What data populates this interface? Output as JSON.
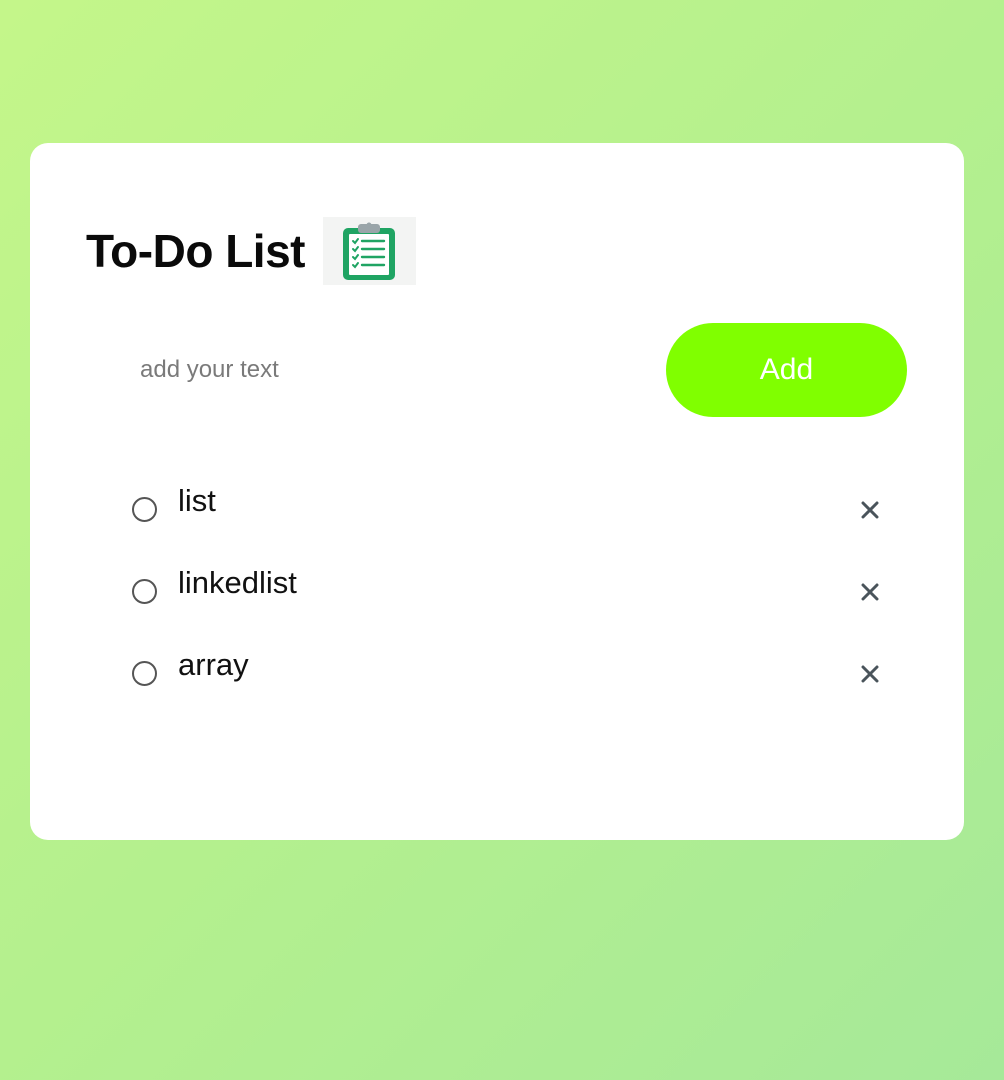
{
  "app": {
    "title": "To-Do List",
    "title_icon": "clipboard-checklist-icon"
  },
  "input": {
    "placeholder": "add your text",
    "value": ""
  },
  "add_button": {
    "label": "Add",
    "color": "#80ff00"
  },
  "todos": [
    {
      "text": "list",
      "checked": false
    },
    {
      "text": "linkedlist",
      "checked": false
    },
    {
      "text": "array",
      "checked": false
    }
  ],
  "icons": {
    "checkbox": "circle-radio-icon",
    "remove": "close-icon"
  }
}
